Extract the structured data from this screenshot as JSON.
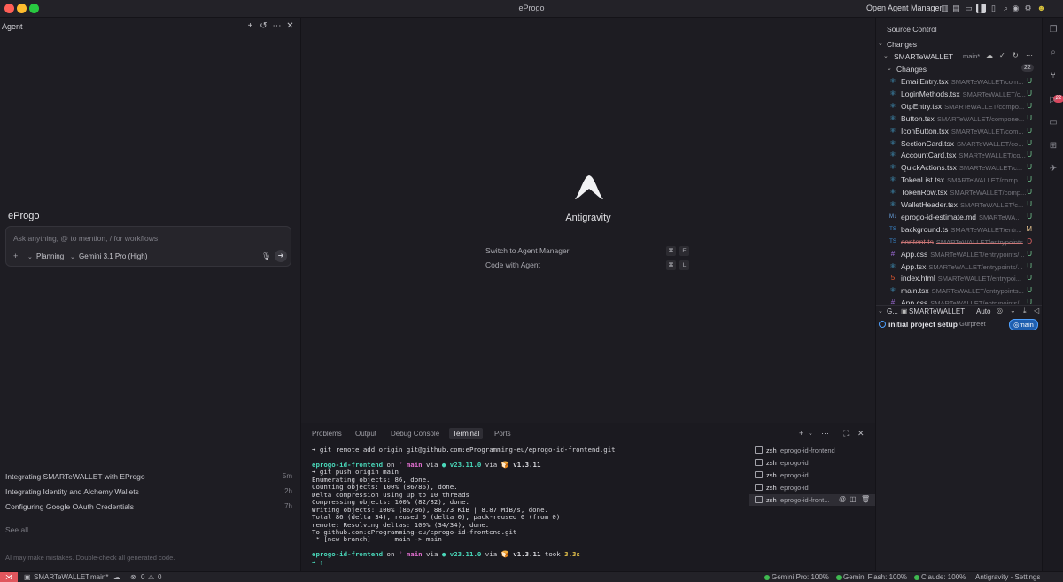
{
  "window": {
    "title": "eProgo",
    "open_agent_manager": "Open Agent Manager"
  },
  "agent_panel": {
    "title": "Agent",
    "workspace": "eProgo",
    "prompt_placeholder": "Ask anything, @ to mention, / for workflows",
    "mode": "Planning",
    "model": "Gemini 3.1 Pro (High)",
    "conversations": [
      {
        "title": "Integrating SMARTeWALLET with EProgo",
        "time": "5m"
      },
      {
        "title": "Integrating Identity and Alchemy Wallets",
        "time": "2h"
      },
      {
        "title": "Configuring Google OAuth Credentials",
        "time": "7h"
      }
    ],
    "see_all": "See all",
    "disclaimer": "AI may make mistakes. Double-check all generated code."
  },
  "editor": {
    "app_name": "Antigravity",
    "commands": [
      {
        "label": "Switch to Agent Manager",
        "keys": [
          "⌘",
          "E"
        ]
      },
      {
        "label": "Code with Agent",
        "keys": [
          "⌘",
          "L"
        ]
      }
    ]
  },
  "panel": {
    "tabs": [
      "Problems",
      "Output",
      "Debug Console",
      "Terminal",
      "Ports"
    ],
    "active_tab": "Terminal",
    "terminal": {
      "line1": "➜ git remote add origin git@github.com:eProgramming-eu/eprogo-id-frontend.git",
      "prompt_dir": "eprogo-id-frontend",
      "on": " on ",
      "branch_icon": "ᚠ",
      "branch": "main",
      "via": " via ",
      "node": "● v23.11.0",
      "via2": " via ",
      "bun": "🍞 v1.3.11",
      "cmd2": "➜ git push origin main",
      "output": [
        "Enumerating objects: 86, done.",
        "Counting objects: 100% (86/86), done.",
        "Delta compression using up to 10 threads",
        "Compressing objects: 100% (82/82), done.",
        "Writing objects: 100% (86/86), 88.73 KiB | 8.87 MiB/s, done.",
        "Total 86 (delta 34), reused 0 (delta 0), pack-reused 0 (from 0)",
        "remote: Resolving deltas: 100% (34/34), done.",
        "To github.com:eProgramming-eu/eprogo-id-frontend.git",
        " * [new branch]      main -> main"
      ],
      "took": " took ",
      "duration": "3.3s",
      "cursor_line": "➜ ▯"
    },
    "terminal_list": [
      {
        "shell": "zsh",
        "name": "eprogo-id-frontend"
      },
      {
        "shell": "zsh",
        "name": "eprogo-id"
      },
      {
        "shell": "zsh",
        "name": "eprogo-id"
      },
      {
        "shell": "zsh",
        "name": "eprogo-id"
      },
      {
        "shell": "zsh",
        "name": "eprogo-id-front..."
      }
    ]
  },
  "source_control": {
    "title": "Source Control",
    "changes_section": "Changes",
    "repo": "SMARTeWALLET",
    "branch": "main*",
    "changes_label": "Changes",
    "changes_count": "22",
    "files": [
      {
        "name": "EmailEntry.tsx",
        "path": "SMARTeWALLET/com...",
        "status": "U",
        "icon": "⚛"
      },
      {
        "name": "LoginMethods.tsx",
        "path": "SMARTeWALLET/c...",
        "status": "U",
        "icon": "⚛"
      },
      {
        "name": "OtpEntry.tsx",
        "path": "SMARTeWALLET/compo...",
        "status": "U",
        "icon": "⚛"
      },
      {
        "name": "Button.tsx",
        "path": "SMARTeWALLET/compone...",
        "status": "U",
        "icon": "⚛"
      },
      {
        "name": "IconButton.tsx",
        "path": "SMARTeWALLET/com...",
        "status": "U",
        "icon": "⚛"
      },
      {
        "name": "SectionCard.tsx",
        "path": "SMARTeWALLET/co...",
        "status": "U",
        "icon": "⚛"
      },
      {
        "name": "AccountCard.tsx",
        "path": "SMARTeWALLET/co...",
        "status": "U",
        "icon": "⚛"
      },
      {
        "name": "QuickActions.tsx",
        "path": "SMARTeWALLET/c...",
        "status": "U",
        "icon": "⚛"
      },
      {
        "name": "TokenList.tsx",
        "path": "SMARTeWALLET/comp...",
        "status": "U",
        "icon": "⚛"
      },
      {
        "name": "TokenRow.tsx",
        "path": "SMARTeWALLET/comp...",
        "status": "U",
        "icon": "⚛"
      },
      {
        "name": "WalletHeader.tsx",
        "path": "SMARTeWALLET/c...",
        "status": "U",
        "icon": "⚛"
      },
      {
        "name": "eprogo-id-estimate.md",
        "path": "SMARTeWA...",
        "status": "U",
        "icon": "M↓"
      },
      {
        "name": "background.ts",
        "path": "SMARTeWALLET/entr...",
        "status": "M",
        "icon": "TS"
      },
      {
        "name": "content.ts",
        "path": "SMARTeWALLET/entrypoints",
        "status": "D",
        "icon": "TS"
      },
      {
        "name": "App.css",
        "path": "SMARTeWALLET/entrypoints/...",
        "status": "U",
        "icon": "#"
      },
      {
        "name": "App.tsx",
        "path": "SMARTeWALLET/entrypoints/...",
        "status": "U",
        "icon": "⚛"
      },
      {
        "name": "index.html",
        "path": "SMARTeWALLET/entrypoi...",
        "status": "U",
        "icon": "5"
      },
      {
        "name": "main.tsx",
        "path": "SMARTeWALLET/entrypoints...",
        "status": "U",
        "icon": "⚛"
      },
      {
        "name": "App.css",
        "path": "SMARTeWALLET/entrypoints/...",
        "status": "U",
        "icon": "#"
      }
    ],
    "graph_label": "G...",
    "graph_repo": "SMARTeWALLET",
    "graph_auto": "Auto",
    "commit_message": "initial project setup",
    "commit_author": "Gurpreet",
    "commit_branch": "main"
  },
  "activity_badge": "22",
  "status_bar": {
    "repo": "SMARTeWALLET",
    "branch": "main*",
    "errors": "0",
    "warnings": "0",
    "gemini_pro": "Gemini Pro: 100%",
    "gemini_flash": "Gemini Flash: 100%",
    "claude": "Claude: 100%",
    "settings": "Antigravity - Settings"
  }
}
